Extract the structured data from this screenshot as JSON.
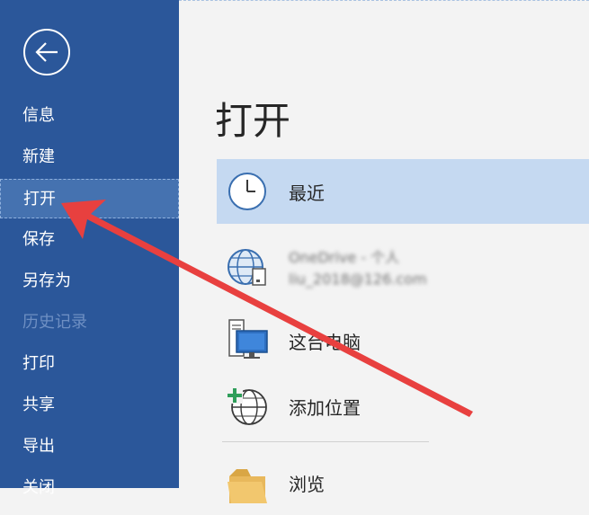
{
  "sidebar": {
    "items": [
      {
        "label": "信息"
      },
      {
        "label": "新建"
      },
      {
        "label": "打开"
      },
      {
        "label": "保存"
      },
      {
        "label": "另存为"
      },
      {
        "label": "历史记录"
      },
      {
        "label": "打印"
      },
      {
        "label": "共享"
      },
      {
        "label": "导出"
      },
      {
        "label": "关闭"
      }
    ]
  },
  "main": {
    "title": "打开",
    "locations": [
      {
        "label": "最近",
        "icon": "clock-icon"
      },
      {
        "label_line1": "OneDrive - 个人",
        "label_line2": "liu_2018@126.com",
        "icon": "globe-cloud-icon"
      },
      {
        "label": "这台电脑",
        "icon": "computer-icon"
      },
      {
        "label": "添加位置",
        "icon": "add-location-globe-icon"
      },
      {
        "label": "浏览",
        "icon": "folder-icon"
      }
    ]
  },
  "colors": {
    "sidebar_bg": "#2b579a",
    "selected_bg": "#c5d9f1",
    "annotation_arrow": "#e8403f"
  }
}
